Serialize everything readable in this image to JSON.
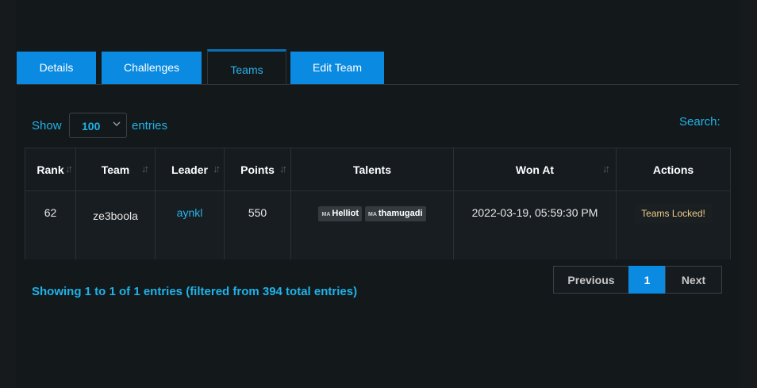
{
  "tabs": [
    {
      "label": "Details"
    },
    {
      "label": "Challenges"
    },
    {
      "label": "Teams"
    },
    {
      "label": "Edit Team"
    }
  ],
  "controls": {
    "show_label": "Show",
    "page_size": "100",
    "entries_label": "entries",
    "search_label": "Search:"
  },
  "table": {
    "headers": [
      "Rank",
      "Team",
      "Leader",
      "Points",
      "Talents",
      "Won At",
      "Actions"
    ],
    "rows": [
      {
        "rank": "62",
        "team": "ze3boola",
        "leader": "aynkl",
        "points": "550",
        "talents": [
          {
            "badge": "MA",
            "name": "Helliot"
          },
          {
            "badge": "MA",
            "name": "thamugadi"
          }
        ],
        "won_at": "2022-03-19, 05:59:30 PM",
        "action": "Teams Locked!"
      }
    ]
  },
  "footer": {
    "info": "Showing 1 to 1 of 1 entries (filtered from 394 total entries)",
    "previous": "Previous",
    "page": "1",
    "next": "Next"
  },
  "colors": {
    "accent": "#0a8ae0",
    "link": "#1fb3e8",
    "background": "#13181b",
    "locked_text": "#f0cc8a"
  }
}
